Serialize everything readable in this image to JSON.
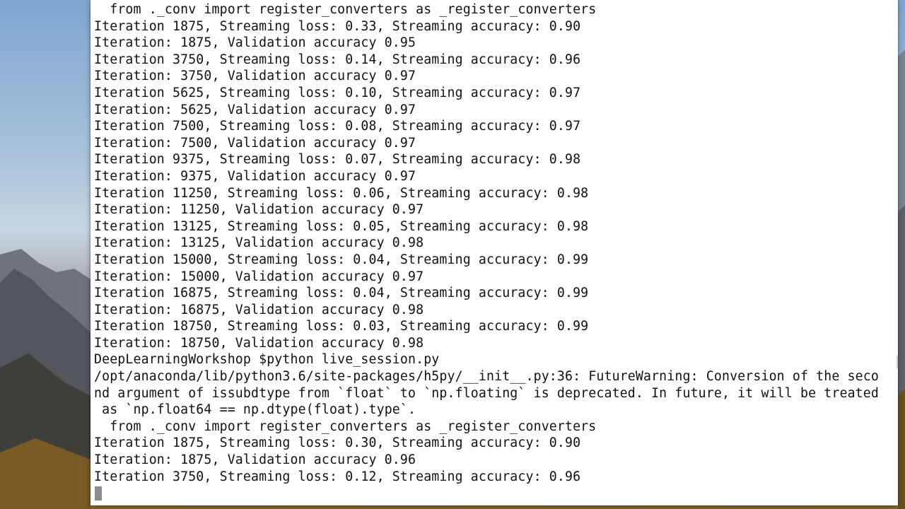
{
  "terminal": {
    "lines": [
      "  from ._conv import register_converters as _register_converters",
      "Iteration 1875, Streaming loss: 0.33, Streaming accuracy: 0.90",
      "Iteration: 1875, Validation accuracy 0.95",
      "Iteration 3750, Streaming loss: 0.14, Streaming accuracy: 0.96",
      "Iteration: 3750, Validation accuracy 0.97",
      "Iteration 5625, Streaming loss: 0.10, Streaming accuracy: 0.97",
      "Iteration: 5625, Validation accuracy 0.97",
      "Iteration 7500, Streaming loss: 0.08, Streaming accuracy: 0.97",
      "Iteration: 7500, Validation accuracy 0.97",
      "Iteration 9375, Streaming loss: 0.07, Streaming accuracy: 0.98",
      "Iteration: 9375, Validation accuracy 0.97",
      "Iteration 11250, Streaming loss: 0.06, Streaming accuracy: 0.98",
      "Iteration: 11250, Validation accuracy 0.97",
      "Iteration 13125, Streaming loss: 0.05, Streaming accuracy: 0.98",
      "Iteration: 13125, Validation accuracy 0.98",
      "Iteration 15000, Streaming loss: 0.04, Streaming accuracy: 0.99",
      "Iteration: 15000, Validation accuracy 0.97",
      "Iteration 16875, Streaming loss: 0.04, Streaming accuracy: 0.99",
      "Iteration: 16875, Validation accuracy 0.98",
      "Iteration 18750, Streaming loss: 0.03, Streaming accuracy: 0.99",
      "Iteration: 18750, Validation accuracy 0.98",
      "DeepLearningWorkshop $python live_session.py",
      "/opt/anaconda/lib/python3.6/site-packages/h5py/__init__.py:36: FutureWarning: Conversion of the seco",
      "nd argument of issubdtype from `float` to `np.floating` is deprecated. In future, it will be treated",
      " as `np.float64 == np.dtype(float).type`.",
      "  from ._conv import register_converters as _register_converters",
      "Iteration 1875, Streaming loss: 0.30, Streaming accuracy: 0.90",
      "Iteration: 1875, Validation accuracy 0.96",
      "Iteration 3750, Streaming loss: 0.12, Streaming accuracy: 0.96"
    ],
    "colors": {
      "background": "#ffffff",
      "text": "#111111",
      "cursor": "#8c8c8c"
    }
  }
}
